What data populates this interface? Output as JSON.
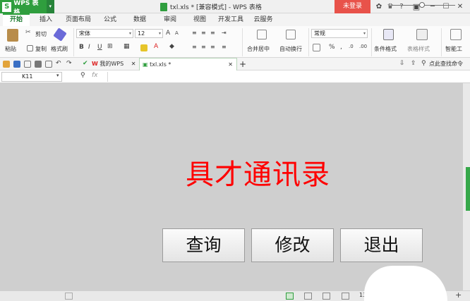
{
  "titlebar": {
    "app_name": "WPS 表格",
    "app_logo": "S",
    "app_menu_arrow": "▾",
    "document_title": "txl.xls * [兼容模式] - WPS 表格",
    "login": "未登录",
    "controls": [
      "?",
      "─",
      "☐",
      "✕"
    ]
  },
  "menu_tabs": [
    "开始",
    "插入",
    "页面布局",
    "公式",
    "数据",
    "审阅",
    "视图",
    "开发工具",
    "云服务"
  ],
  "ribbon": {
    "paste": "粘贴",
    "cut": "剪切",
    "copy": "复制",
    "format_painter": "格式刷",
    "font_name": "宋体",
    "font_size": "12",
    "bold": "B",
    "italic": "I",
    "underline": "U",
    "merge_center": "合并居中",
    "wrap_text": "自动换行",
    "number_format": "常规",
    "percent": "%",
    "conditional_format": "条件格式",
    "table_style": "表格样式",
    "smart_tools": "智能工",
    "grow_font": "A",
    "shrink_font": "A"
  },
  "doc_tabs": {
    "home": "我的WPS",
    "file": "txl.xls *",
    "add": "+",
    "search_cmd": "点此查找命令"
  },
  "formula_bar": {
    "name_box": "K11",
    "fx": "fx",
    "value": ""
  },
  "sheet": {
    "banner_title": "具才通讯录",
    "buttons": [
      "查询",
      "修改",
      "退出"
    ]
  },
  "statusbar": {
    "zoom": "130 %"
  },
  "colors": {
    "brand_green": "#2f9e3e",
    "login_red": "#e8524a",
    "banner_red": "#ff0000"
  }
}
